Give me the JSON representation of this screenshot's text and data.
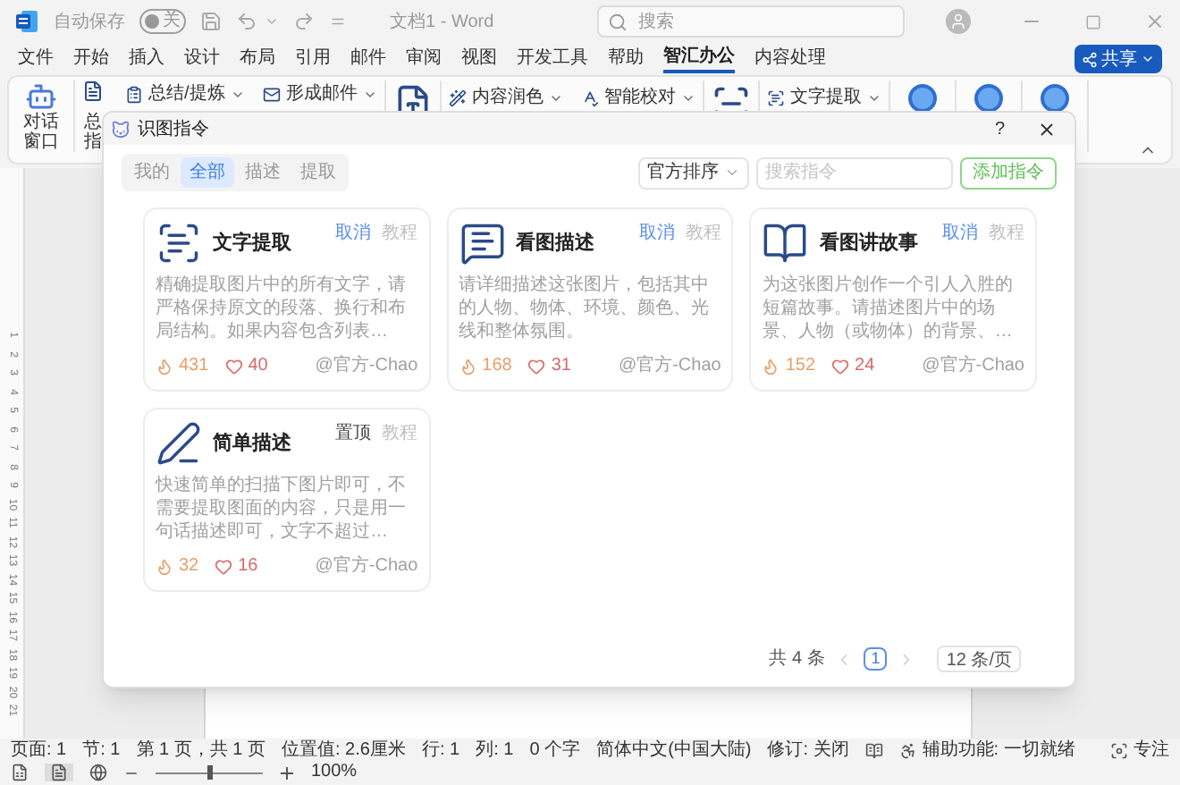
{
  "titlebar": {
    "autosave_label": "自动保存",
    "autosave": {
      "on": false,
      "label": "关"
    },
    "doc_title": "文档1 - Word",
    "search": {
      "placeholder": "搜索"
    }
  },
  "menu": [
    {
      "label": "文件",
      "selected": false
    },
    {
      "label": "开始",
      "selected": false
    },
    {
      "label": "插入",
      "selected": false
    },
    {
      "label": "设计",
      "selected": false
    },
    {
      "label": "布局",
      "selected": false
    },
    {
      "label": "引用",
      "selected": false
    },
    {
      "label": "邮件",
      "selected": false
    },
    {
      "label": "审阅",
      "selected": false
    },
    {
      "label": "视图",
      "selected": false
    },
    {
      "label": "开发工具",
      "selected": false
    },
    {
      "label": "帮助",
      "selected": false
    },
    {
      "label": "智汇办公",
      "selected": true
    },
    {
      "label": "内容处理",
      "selected": false
    }
  ],
  "share_button": "共享",
  "ribbon": {
    "large": [
      [
        "对话",
        "窗口"
      ],
      [
        "总",
        "指"
      ]
    ],
    "tools": [
      "总结/提炼",
      "形成邮件",
      "内容润色",
      "智能校对",
      "文字提取"
    ]
  },
  "ruler_numbers": [
    "1",
    "2",
    "3",
    "4",
    "5",
    "6",
    "7",
    "8",
    "9",
    "10",
    "11",
    "12",
    "13",
    "14",
    "15",
    "16",
    "17",
    "18",
    "19",
    "20",
    "21"
  ],
  "dialog": {
    "title": "识图指令",
    "help": "?",
    "filters": [
      {
        "label": "我的",
        "selected": false
      },
      {
        "label": "全部",
        "selected": true
      },
      {
        "label": "描述",
        "selected": false
      },
      {
        "label": "提取",
        "selected": false
      }
    ],
    "sort": "官方排序",
    "search": {
      "placeholder": "搜索指令"
    },
    "add_button": "添加指令",
    "cards": [
      {
        "title": "文字提取",
        "pinned": true,
        "pin_action": "取消",
        "tutorial": "教程",
        "description": "精确提取图片中的所有文字，请严格保持原文的段落、换行和布局结构。如果内容包含列表…",
        "views": "431",
        "likes": "40",
        "author": "@官方-Chao"
      },
      {
        "title": "看图描述",
        "pinned": true,
        "pin_action": "取消",
        "tutorial": "教程",
        "description": "请详细描述这张图片，包括其中的人物、物体、环境、颜色、光线和整体氛围。",
        "views": "168",
        "likes": "31",
        "author": "@官方-Chao"
      },
      {
        "title": "看图讲故事",
        "pinned": true,
        "pin_action": "取消",
        "tutorial": "教程",
        "description": "为这张图片创作一个引人入胜的短篇故事。请描述图片中的场景、人物（或物体）的背景、…",
        "views": "152",
        "likes": "24",
        "author": "@官方-Chao"
      },
      {
        "title": "简单描述",
        "pinned": false,
        "pin_action": "置顶",
        "tutorial": "教程",
        "description": "快速简单的扫描下图片即可，不需要提取图面的内容，只是用一句话描述即可，文字不超过…",
        "views": "32",
        "likes": "16",
        "author": "@官方-Chao"
      }
    ],
    "pagination": {
      "total": "共 4 条",
      "pages": [
        {
          "label": "1",
          "selected": true
        }
      ],
      "page_size": "12 条/页"
    }
  },
  "status_bar": {
    "items": [
      "页面: 1",
      "节: 1",
      "第 1 页，共 1 页",
      "位置值: 2.6厘米",
      "行: 1",
      "列: 1",
      "0 个字",
      "简体中文(中国大陆)",
      "修订: 关闭"
    ],
    "accessibility": "辅助功能: 一切就绪",
    "focus": "专注",
    "zoom": {
      "level": 0.5,
      "reading": "100%"
    }
  }
}
